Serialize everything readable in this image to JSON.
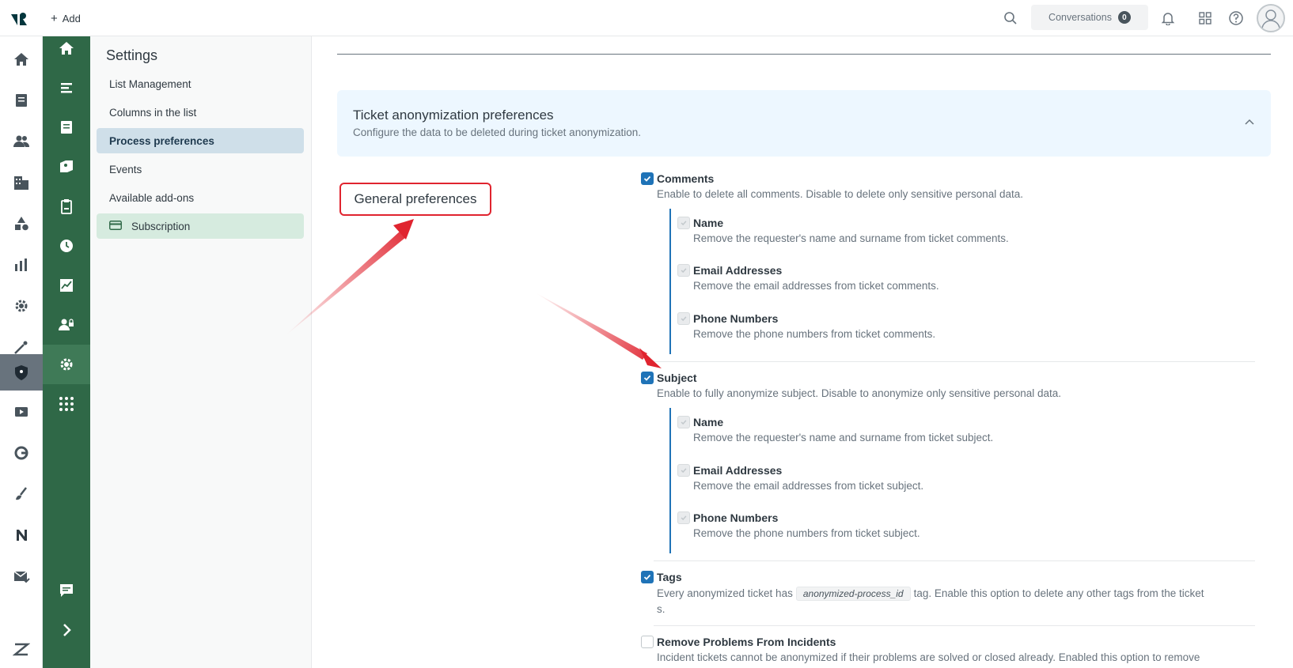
{
  "topbar": {
    "add_label": "Add",
    "conversations_label": "Conversations",
    "conversations_count": "0"
  },
  "settings": {
    "title": "Settings",
    "items": [
      {
        "label": "List Management"
      },
      {
        "label": "Columns in the list"
      },
      {
        "label": "Process preferences"
      },
      {
        "label": "Events"
      },
      {
        "label": "Available add-ons"
      },
      {
        "label": "Subscription"
      }
    ]
  },
  "banner": {
    "title": "Ticket anonymization preferences",
    "description": "Configure the data to be deleted during ticket anonymization."
  },
  "annotation": {
    "label": "General preferences",
    "color": "#e0242f"
  },
  "options": {
    "comments": {
      "title": "Comments",
      "desc": "Enable to delete all comments. Disable to delete only sensitive personal data.",
      "checked": true,
      "sub": [
        {
          "title": "Name",
          "desc": "Remove the requester's name and surname from ticket comments."
        },
        {
          "title": "Email Addresses",
          "desc": "Remove the email addresses from ticket comments."
        },
        {
          "title": "Phone Numbers",
          "desc": "Remove the phone numbers from ticket comments."
        }
      ]
    },
    "subject": {
      "title": "Subject",
      "desc": "Enable to fully anonymize subject. Disable to anonymize only sensitive personal data.",
      "checked": true,
      "sub": [
        {
          "title": "Name",
          "desc": "Remove the requester's name and surname from ticket subject."
        },
        {
          "title": "Email Addresses",
          "desc": "Remove the email addresses from ticket subject."
        },
        {
          "title": "Phone Numbers",
          "desc": "Remove the phone numbers from ticket subject."
        }
      ]
    },
    "tags": {
      "title": "Tags",
      "desc_before": "Every anonymized ticket has",
      "tag": "anonymized-process_id",
      "desc_after": "tag. Enable this option to delete any other tags from the ticket",
      "desc_wrap": "s.",
      "checked": true
    },
    "incidents": {
      "title": "Remove Problems From Incidents",
      "desc": "Incident tickets cannot be anonymized if their problems are solved or closed already. Enabled this option to remove",
      "checked": false
    }
  },
  "colors": {
    "brand_green": "#2f6847",
    "accent_blue": "#1f73b7",
    "banner_bg": "#edf7ff"
  }
}
